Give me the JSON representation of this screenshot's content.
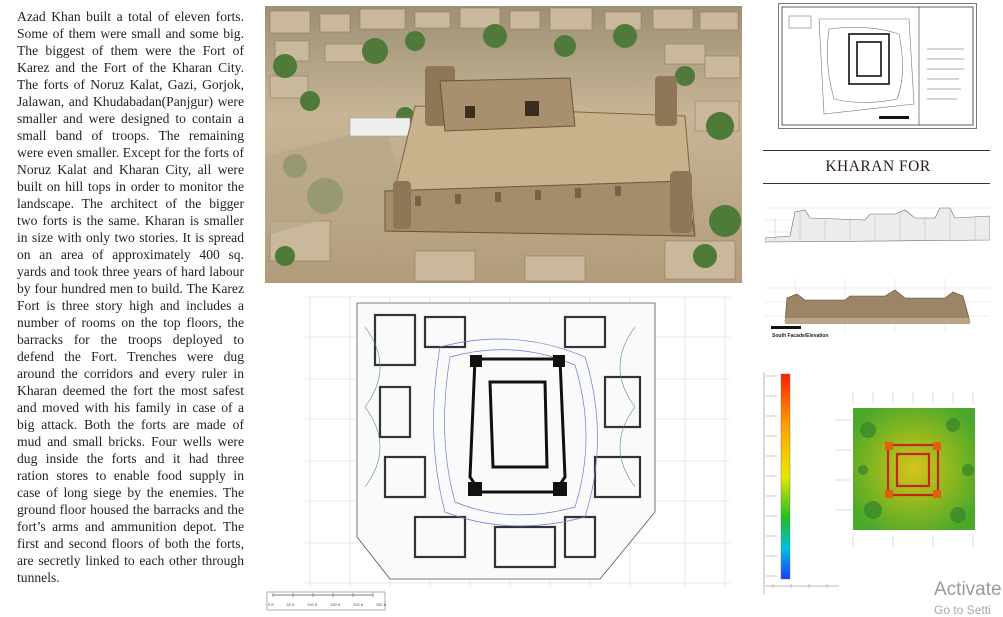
{
  "article": {
    "body": "Azad Khan built a total of eleven forts. Some of them were small and some big. The biggest of them were the Fort of Karez and the Fort of the Kharan City. The forts of Noruz Kalat, Gazi, Gorjok, Jalawan, and Khudabadan(Panjgur) were smaller and were designed to contain a small band of troops. The remaining were even smaller. Except for the forts of Noruz Kalat and Kharan City, all were built on hill tops in order to monitor the landscape. The architect of the bigger two forts is the same. Kharan is smaller in size with only two stories. It is spread on an area of approximately 400 sq. yards and took three years of hard labour by four hundred men to build. The Karez Fort is three story high and includes a number of rooms on the top floors, the barracks for the troops deployed to defend the Fort. Trenches were dug around the corridors and every ruler in Kharan deemed the fort the most safest and moved with his family in case of a big attack. Both the forts are made of mud and small bricks. Four wells were dug inside the forts and it had three ration stores to enable food supply in case of long siege by the enemies. The ground floor housed the barracks and the fort’s arms and ammunition depot. The first and second floors of both the forts, are secretly linked to each other through tunnels."
  },
  "panel": {
    "title": "KHARAN FOR",
    "elevation_caption": "South Facade/Elevation"
  },
  "map": {
    "scale_labels": [
      "0 ft",
      "50 ft",
      "100 ft",
      "150 ft",
      "200 ft",
      "250 ft"
    ]
  },
  "colors": {
    "mud_wall": "#a58d6c",
    "sand": "#d8c6a6",
    "palm": "#4f7a3a",
    "heat_low": "#1a3cff",
    "heat_high": "#ff2000"
  },
  "os_overlay": {
    "activate_title": "Activate",
    "activate_sub": "Go to Setti"
  }
}
